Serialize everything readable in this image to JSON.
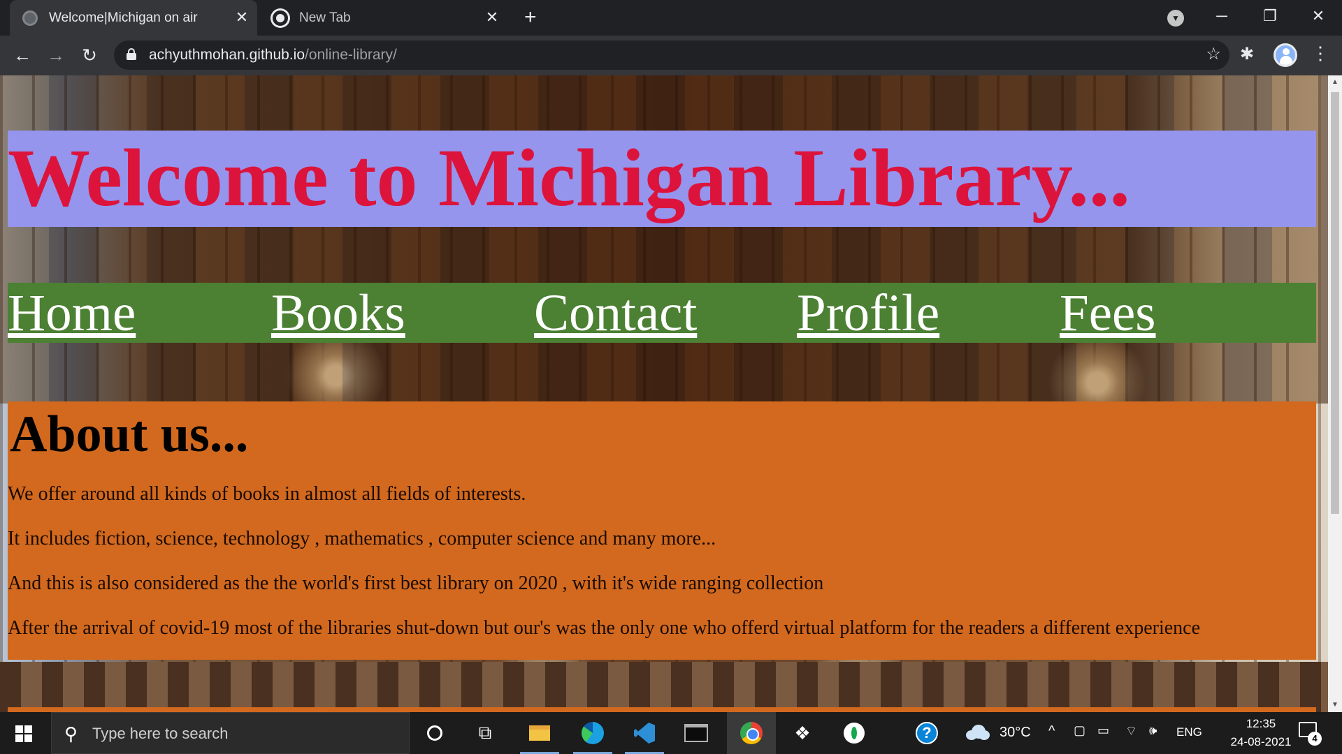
{
  "browser": {
    "tabs": [
      {
        "title": "Welcome|Michigan on air",
        "active": true
      },
      {
        "title": "New Tab",
        "active": false
      }
    ],
    "new_tab_symbol": "+",
    "close_symbol": "✕",
    "url_host": "achyuthmohan.github.io",
    "url_path": "/online-library/",
    "window_controls": {
      "minimize": "─",
      "restore": "❐",
      "close": "✕"
    },
    "back_symbol": "←",
    "forward_symbol": "→",
    "reload_symbol": "↻",
    "star_symbol": "☆",
    "extensions_symbol": "✱",
    "menu_symbol": "⋮",
    "profile_dropdown_symbol": "▼"
  },
  "page": {
    "title": "Welcome to Michigan Library...",
    "nav": [
      "Home",
      "Books",
      "Contact",
      "Profile",
      "Fees"
    ],
    "about_heading": "About us...",
    "about_paragraphs": [
      "We offer around all kinds of books in almost all fields of interests.",
      "It includes fiction, science, technology , mathematics , computer science and many more...",
      "And this is also considered as the the world's first best library on 2020 , with it's wide ranging collection",
      "After the arrival of covid-19 most of the libraries shut-down but our's was the only one who offerd virtual platform for the readers a different experience"
    ],
    "colors": {
      "header_bg": "#9595ee",
      "title_color": "#dc143c",
      "nav_bg": "#4c8033",
      "about_bg": "#d2691e"
    }
  },
  "taskbar": {
    "search_placeholder": "Type here to search",
    "apps": [
      "cortana",
      "task-view",
      "file-explorer",
      "edge",
      "vscode",
      "terminal",
      "chrome",
      "dropbox",
      "green-app",
      "help"
    ],
    "weather_temp": "30°C",
    "language": "ENG",
    "time": "12:35",
    "date": "24-08-2021",
    "notification_count": "4",
    "tray_up_symbol": "^"
  }
}
